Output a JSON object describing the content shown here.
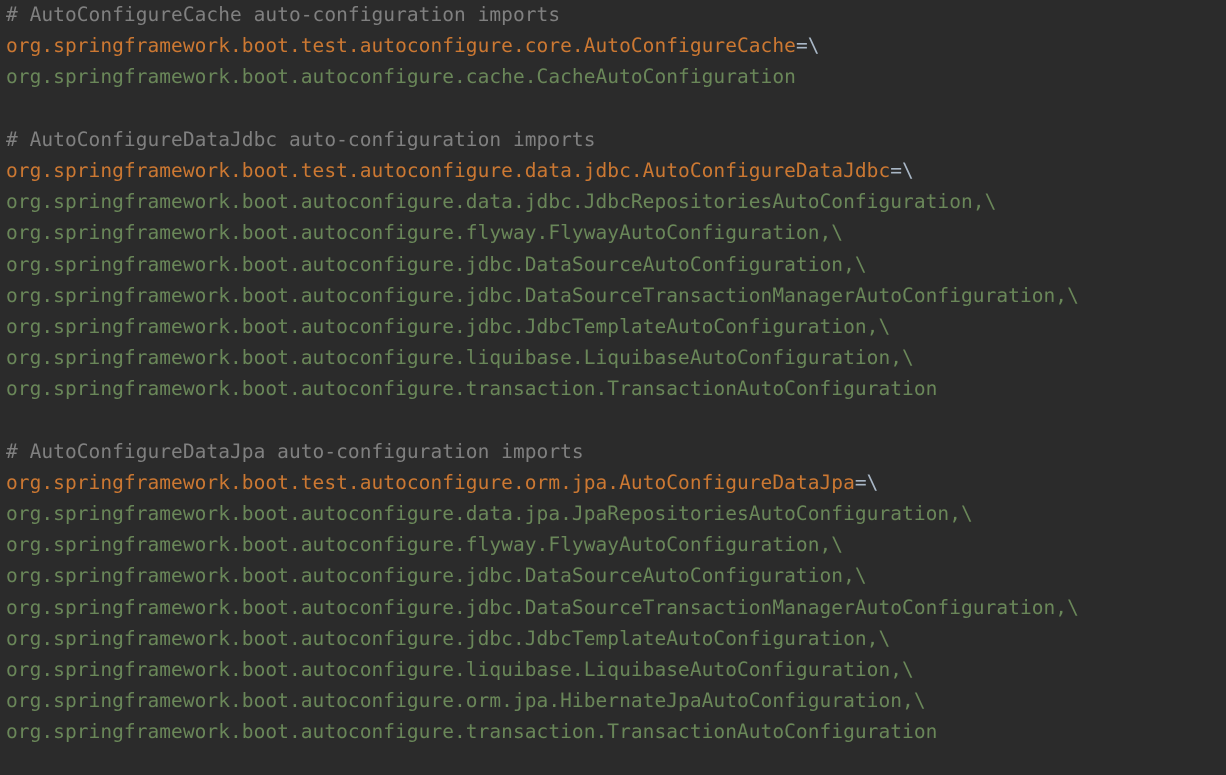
{
  "colors": {
    "background": "#2b2b2b",
    "comment": "#808080",
    "key": "#cc7832",
    "separator": "#a9b7c6",
    "value": "#6a8759"
  },
  "lines": [
    {
      "type": "comment",
      "text": "# AutoConfigureCache auto-configuration imports"
    },
    {
      "type": "key",
      "key": "org.springframework.boot.test.autoconfigure.core.AutoConfigureCache",
      "sep": "=\\"
    },
    {
      "type": "value",
      "text": "org.springframework.boot.autoconfigure.cache.CacheAutoConfiguration"
    },
    {
      "type": "blank",
      "text": ""
    },
    {
      "type": "comment",
      "text": "# AutoConfigureDataJdbc auto-configuration imports"
    },
    {
      "type": "key",
      "key": "org.springframework.boot.test.autoconfigure.data.jdbc.AutoConfigureDataJdbc",
      "sep": "=\\"
    },
    {
      "type": "value",
      "text": "org.springframework.boot.autoconfigure.data.jdbc.JdbcRepositoriesAutoConfiguration,\\"
    },
    {
      "type": "value",
      "text": "org.springframework.boot.autoconfigure.flyway.FlywayAutoConfiguration,\\"
    },
    {
      "type": "value",
      "text": "org.springframework.boot.autoconfigure.jdbc.DataSourceAutoConfiguration,\\"
    },
    {
      "type": "value",
      "text": "org.springframework.boot.autoconfigure.jdbc.DataSourceTransactionManagerAutoConfiguration,\\"
    },
    {
      "type": "value",
      "text": "org.springframework.boot.autoconfigure.jdbc.JdbcTemplateAutoConfiguration,\\"
    },
    {
      "type": "value",
      "text": "org.springframework.boot.autoconfigure.liquibase.LiquibaseAutoConfiguration,\\"
    },
    {
      "type": "value",
      "text": "org.springframework.boot.autoconfigure.transaction.TransactionAutoConfiguration"
    },
    {
      "type": "blank",
      "text": ""
    },
    {
      "type": "comment",
      "text": "# AutoConfigureDataJpa auto-configuration imports"
    },
    {
      "type": "key",
      "key": "org.springframework.boot.test.autoconfigure.orm.jpa.AutoConfigureDataJpa",
      "sep": "=\\"
    },
    {
      "type": "value",
      "text": "org.springframework.boot.autoconfigure.data.jpa.JpaRepositoriesAutoConfiguration,\\"
    },
    {
      "type": "value",
      "text": "org.springframework.boot.autoconfigure.flyway.FlywayAutoConfiguration,\\"
    },
    {
      "type": "value",
      "text": "org.springframework.boot.autoconfigure.jdbc.DataSourceAutoConfiguration,\\"
    },
    {
      "type": "value",
      "text": "org.springframework.boot.autoconfigure.jdbc.DataSourceTransactionManagerAutoConfiguration,\\"
    },
    {
      "type": "value",
      "text": "org.springframework.boot.autoconfigure.jdbc.JdbcTemplateAutoConfiguration,\\"
    },
    {
      "type": "value",
      "text": "org.springframework.boot.autoconfigure.liquibase.LiquibaseAutoConfiguration,\\"
    },
    {
      "type": "value",
      "text": "org.springframework.boot.autoconfigure.orm.jpa.HibernateJpaAutoConfiguration,\\"
    },
    {
      "type": "value",
      "text": "org.springframework.boot.autoconfigure.transaction.TransactionAutoConfiguration"
    }
  ]
}
